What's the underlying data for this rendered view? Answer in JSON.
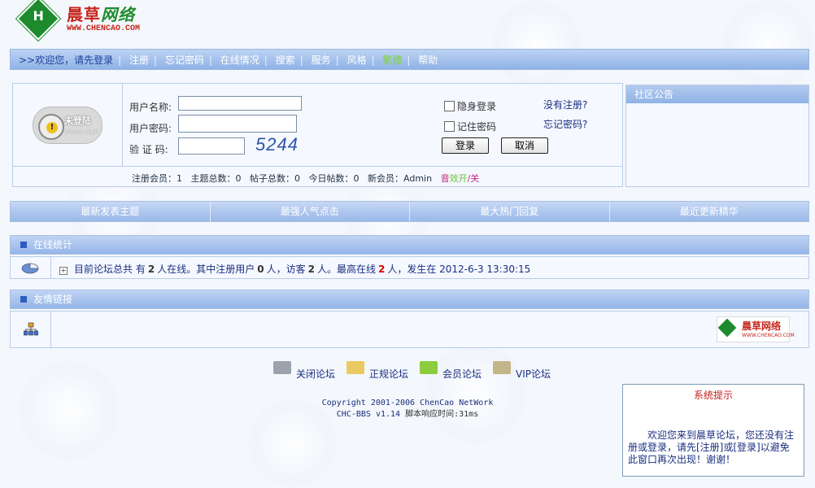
{
  "logo": {
    "name_cn_1": "晨草",
    "name_cn_2": "网络",
    "badge": "H",
    "url": "WWW.CHENCAO.COM"
  },
  "nav": {
    "items": [
      ">>欢迎您，请先登录",
      "注册",
      "忘记密码",
      "在线情况",
      "搜索",
      "服务",
      "风格",
      "繁體",
      "帮助"
    ],
    "colors": {
      "lead": "#1d3f9a",
      "traditional": "#7fd43a"
    }
  },
  "login": {
    "avatar_title": "未登陆",
    "avatar_sub": "please login",
    "username_label": "用户名称:",
    "password_label": "用户密码:",
    "captcha_label": "验 证 码:",
    "captcha_value": "5244",
    "hidden_login": "隐身登录",
    "remember_password": "记住密码",
    "no_register": "没有注册?",
    "forgot_password": "忘记密码?",
    "login_button": "登录",
    "cancel_button": "取消",
    "stats": {
      "members": "注册会员：1",
      "topics": "主题总数：0",
      "posts": "帖子总数：0",
      "today": "今日帖数：0",
      "new_member": "新会员：Admin",
      "sound_a": "音",
      "sound_b": "效开",
      "sound_c": "/关"
    }
  },
  "notice": {
    "title": "社区公告"
  },
  "tabs": [
    "最新发表主题",
    "最强人气点击",
    "最大热门回复",
    "最近更新精华"
  ],
  "online": {
    "title": "在线统计",
    "t1": "目前论坛总共 有",
    "total": "2",
    "t2": "人在线。其中注册用户",
    "registered": "0",
    "t3": "人，访客",
    "guests": "2",
    "t4": "人。最高在线",
    "max": "2",
    "t5": "人，发生在 2012-6-3 13:30:15"
  },
  "links": {
    "title": "友情链接",
    "partner_logo_text": "晨草网络",
    "partner_logo_url": "WWW.CHENCAO.COM"
  },
  "forum_types": [
    {
      "label": "关闭论坛",
      "color": "#9aa3ad"
    },
    {
      "label": "正规论坛",
      "color": "#e9c960"
    },
    {
      "label": "会员论坛",
      "color": "#8ccc3e"
    },
    {
      "label": "VIP论坛",
      "color": "#c4b48a"
    }
  ],
  "footer": {
    "copyright": "Copyright 2001-2006 ChenCao NetWork",
    "version": "CHC-BBS v1.14",
    "response": "脚本响应时间:31ms"
  },
  "system_tip": {
    "title": "系统提示",
    "text": "欢迎您来到晨草论坛，您还没有注册或登录，请先[注册]或[登录]以避免此窗口再次出现！谢谢！"
  }
}
